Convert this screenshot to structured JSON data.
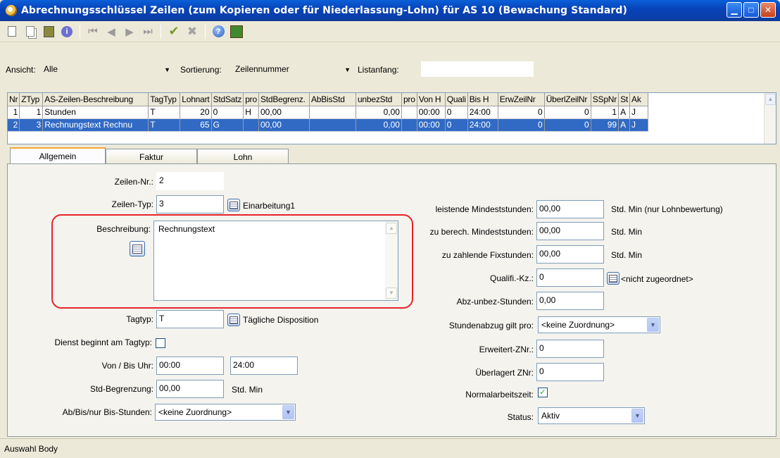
{
  "window": {
    "title": "Abrechnungsschlüssel Zeilen (zum Kopieren oder für Niederlassung-Lohn) für AS 10 (Bewachung Standard)"
  },
  "toolbar": {
    "buttons": [
      "new-icon",
      "copy-icon",
      "calculator-icon",
      "info-icon",
      "first-record-icon",
      "previous-record-icon",
      "next-record-icon",
      "last-record-icon",
      "save-check-icon",
      "cancel-x-icon",
      "help-icon",
      "exit-icon"
    ]
  },
  "filter": {
    "view_label": "Ansicht:",
    "view_value": "Alle",
    "sort_label": "Sortierung:",
    "sort_value": "Zeilennummer",
    "list_start_label": "Listanfang:",
    "list_start_value": ""
  },
  "grid": {
    "columns": [
      "Nr",
      "ZTyp",
      "AS-Zeilen-Beschreibung",
      "TagTyp",
      "Lohnart",
      "StdSatz",
      "pro",
      "StdBegrenz.",
      "AbBisStd",
      "unbezStd",
      "pro",
      "Von H",
      "Quali",
      "Bis H",
      "ErwZeilNr",
      "ÜberlZeilNr",
      "SSpNr",
      "St",
      "Ak"
    ],
    "rows": [
      [
        "1",
        "1",
        "Stunden",
        "T",
        "20",
        "0",
        "H",
        "00,00",
        "",
        "0,00",
        "",
        "00:00",
        "0",
        "24:00",
        "0",
        "0",
        "1",
        "A",
        "J"
      ],
      [
        "2",
        "3",
        "Rechnungstext Rechnu",
        "T",
        "65",
        "G",
        "",
        "00,00",
        "",
        "0,00",
        "",
        "00:00",
        "0",
        "24:00",
        "0",
        "0",
        "99",
        "A",
        "J"
      ]
    ]
  },
  "tabs": [
    {
      "label": "Allgemein",
      "active": true
    },
    {
      "label": "Faktur",
      "active": false
    },
    {
      "label": "Lohn",
      "active": false
    }
  ],
  "form": {
    "zeilen_nr_label": "Zeilen-Nr.:",
    "zeilen_nr_value": "2",
    "zeilen_typ_label": "Zeilen-Typ:",
    "zeilen_typ_value": "3",
    "zeilen_typ_text": "Einarbeitung1",
    "beschreibung_label": "Beschreibung:",
    "beschreibung_value": "Rechnungstext",
    "tagtyp_label": "Tagtyp:",
    "tagtyp_value": "T",
    "tagtyp_text": "Tägliche Disposition",
    "dienst_label": "Dienst beginnt am Tagtyp:",
    "von_bis_label": "Von / Bis Uhr:",
    "von_value": "00:00",
    "bis_value": "24:00",
    "std_begrenzung_label": "Std-Begrenzung:",
    "std_begrenzung_value": "00,00",
    "std_begrenzung_unit": "Std. Min",
    "ab_bis_label": "Ab/Bis/nur Bis-Stunden:",
    "ab_bis_value": "<keine Zuordnung>",
    "leistende_label": "leistende Mindeststunden:",
    "leistende_value": "00,00",
    "leistende_unit": "Std. Min  (nur Lohnbewertung)",
    "berech_label": "zu berech. Mindeststunden:",
    "berech_value": "00,00",
    "berech_unit": "Std. Min",
    "fix_label": "zu zahlende Fixstunden:",
    "fix_value": "00,00",
    "fix_unit": "Std. Min",
    "quali_label": "Qualifi.-Kz.:",
    "quali_value": "0",
    "quali_text": "<nicht zugeordnet>",
    "abz_label": "Abz-unbez-Stunden:",
    "abz_value": "0,00",
    "abzug_label": "Stundenabzug gilt pro:",
    "abzug_value": "<keine Zuordnung>",
    "erweitert_label": "Erweitert-ZNr.:",
    "erweitert_value": "0",
    "ueberlagert_label": "Überlagert ZNr:",
    "ueberlagert_value": "0",
    "normal_label": "Normalarbeitszeit:",
    "normal_checked": true,
    "status_label": "Status:",
    "status_value": "Aktiv"
  },
  "statusbar": {
    "text": "Auswahl Body"
  },
  "colors": {
    "selection": "#316ac5",
    "highlight_frame": "#e8232a",
    "titlebar": "#0842b8"
  }
}
